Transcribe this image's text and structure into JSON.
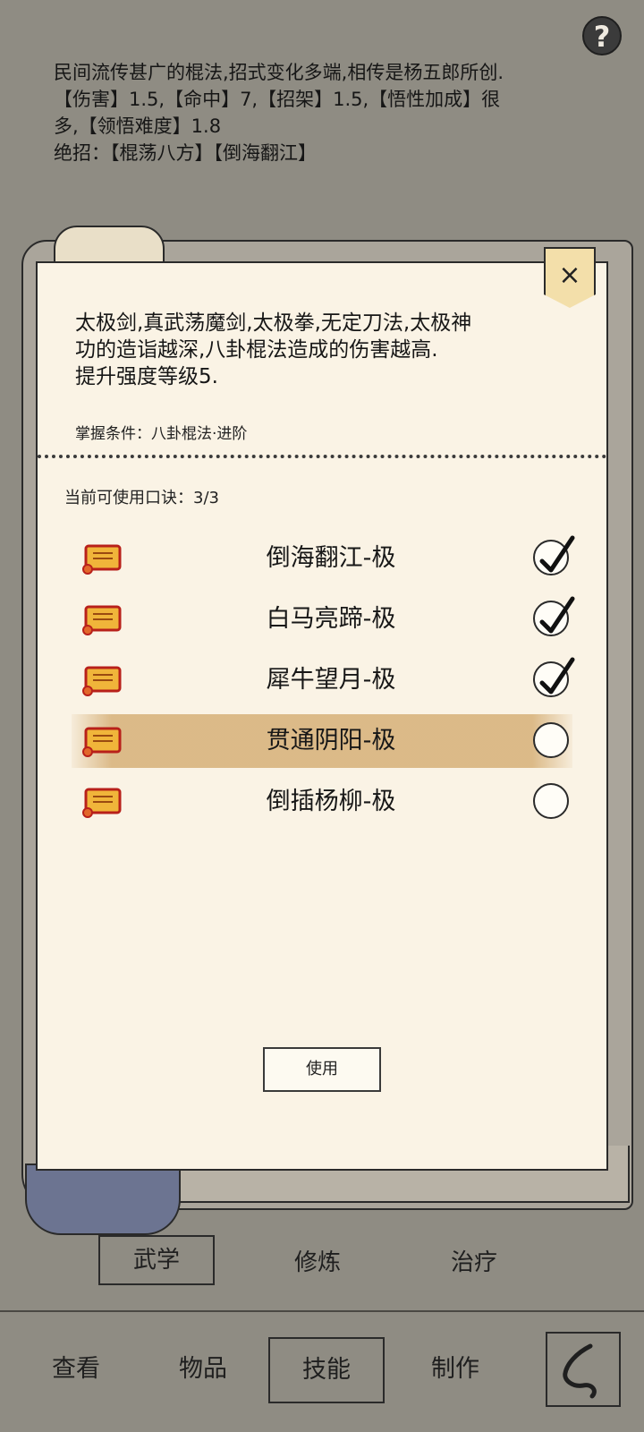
{
  "help": {
    "label": "?"
  },
  "description": {
    "line1": "民间流传甚广的棍法,招式变化多端,相传是杨五郎所创.",
    "line2": "【伤害】1.5,【命中】7,【招架】1.5,【悟性加成】很",
    "line3": "多,【领悟难度】1.8",
    "line4": "绝招：【棍荡八方】【倒海翻江】"
  },
  "panel": {
    "close_label": "×",
    "text_line1": "太极剑,真武荡魔剑,太极拳,无定刀法,太极神",
    "text_line2": "功的造诣越深,八卦棍法造成的伤害越高.",
    "text_line3": "提升强度等级5.",
    "condition": "掌握条件：八卦棍法·进阶",
    "available": "当前可使用口诀：3/3",
    "use_button": "使用",
    "items": [
      {
        "label": "倒海翻江-极",
        "checked": true
      },
      {
        "label": "白马亮蹄-极",
        "checked": true
      },
      {
        "label": "犀牛望月-极",
        "checked": true
      },
      {
        "label": "贯通阴阳-极",
        "checked": false
      },
      {
        "label": "倒插杨柳-极",
        "checked": false
      }
    ]
  },
  "subtabs": {
    "martial": "武学",
    "cultivate": "修炼",
    "heal": "治疗"
  },
  "nav": {
    "view": "查看",
    "items": "物品",
    "skills": "技能",
    "craft": "制作"
  },
  "icons": {
    "item_icon": "scroll-icon",
    "back": "back-arrow-icon",
    "check": "checkmark-icon"
  },
  "colors": {
    "background": "#8f8c83",
    "panel": "#faf3e5",
    "highlight": "#d6b078",
    "scroll_roll": "#6c7491"
  }
}
